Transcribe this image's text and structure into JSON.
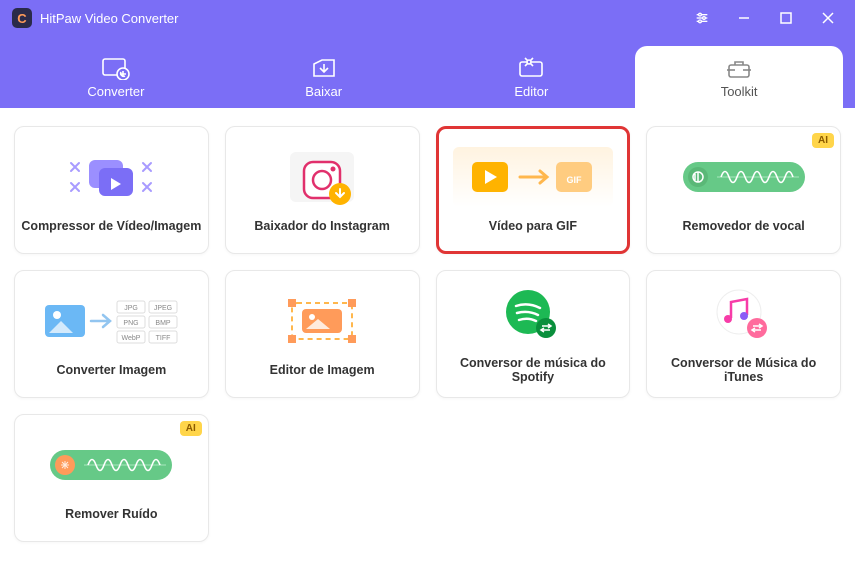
{
  "titlebar": {
    "app_name": "HitPaw Video Converter"
  },
  "tabs": {
    "converter": "Converter",
    "baixar": "Baixar",
    "editor": "Editor",
    "toolkit": "Toolkit"
  },
  "cards": {
    "compressor": "Compressor de Vídeo/Imagem",
    "instagram": "Baixador do Instagram",
    "video_gif": "Vídeo para GIF",
    "vocal": "Removedor de vocal",
    "conv_img": "Converter Imagem",
    "edit_img": "Editor de Imagem",
    "spotify": "Conversor de música do Spotify",
    "itunes": "Conversor de Música do iTunes",
    "noise": "Remover Ruído"
  },
  "badges": {
    "ai": "AI"
  },
  "formats": {
    "jpg": "JPG",
    "jpeg": "JPEG",
    "png": "PNG",
    "bmp": "BMP",
    "webp": "WebP",
    "tiff": "TIFF"
  }
}
